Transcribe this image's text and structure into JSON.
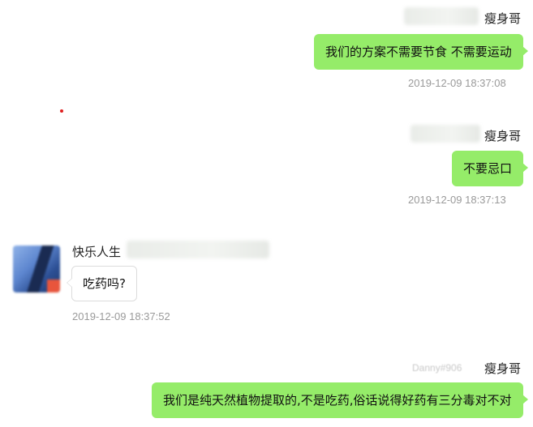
{
  "messages": [
    {
      "sender": "瘦身哥",
      "text": "我们的方案不需要节食 不需要运动",
      "time": "2019-12-09 18:37:08"
    },
    {
      "sender": "瘦身哥",
      "text": "不要忌口",
      "time": "2019-12-09 18:37:13"
    },
    {
      "sender": "快乐人生",
      "text": "吃药吗?",
      "time": "2019-12-09 18:37:52"
    },
    {
      "sender": "瘦身哥",
      "text": "我们是纯天然植物提取的,不是吃药,俗话说得好药有三分毒对不对",
      "faint_prefix": "Danny#906"
    }
  ]
}
